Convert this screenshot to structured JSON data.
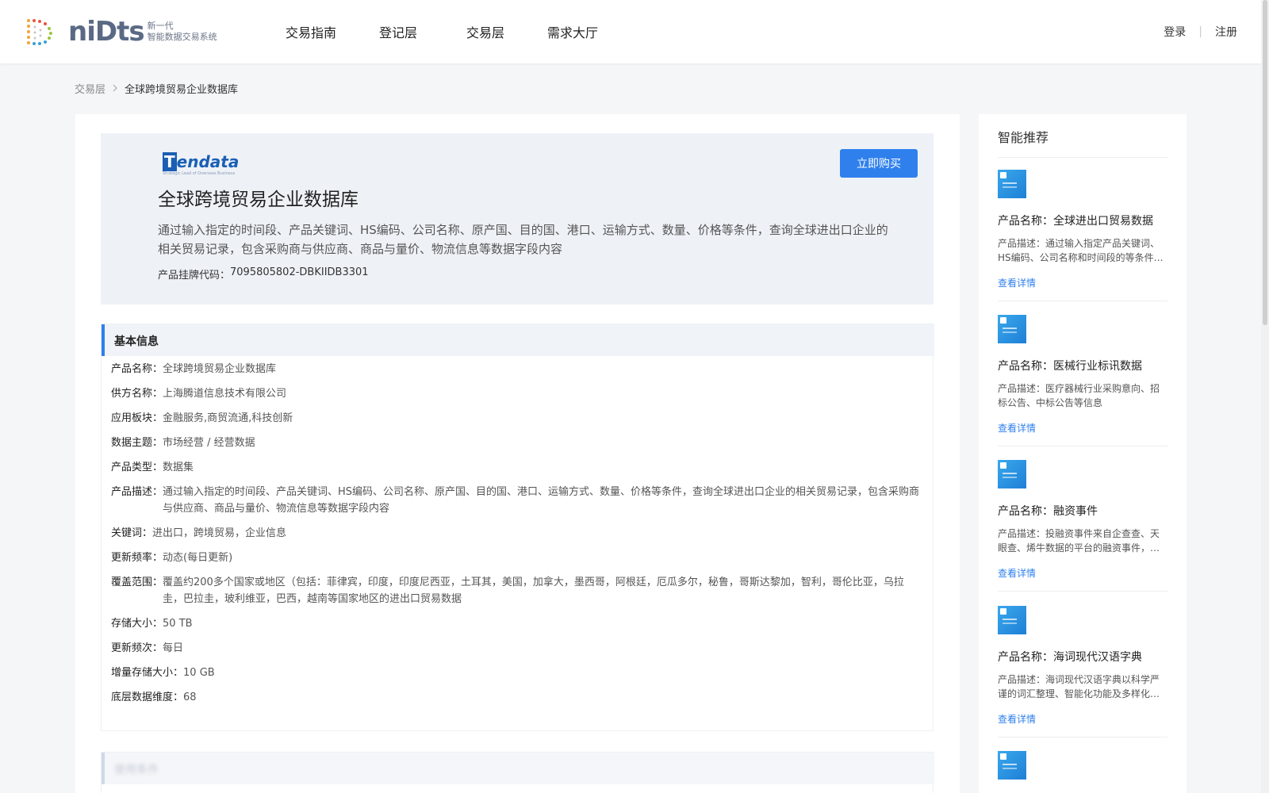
{
  "header": {
    "logo_text": "niDts",
    "logo_sub_line1": "新一代",
    "logo_sub_line2": "智能数据交易系统",
    "nav": [
      "交易指南",
      "登记层",
      "交易层",
      "需求大厅"
    ],
    "login": "登录",
    "separator": "|",
    "register": "注册"
  },
  "breadcrumb": {
    "parent": "交易层",
    "current": "全球跨境贸易企业数据库"
  },
  "hero": {
    "brand_main": "endata",
    "brand_letter": "T",
    "brand_sub": "Strategic Lead of Overseas Business",
    "buy_label": "立即购买",
    "title": "全球跨境贸易企业数据库",
    "description": "通过输入指定的时间段、产品关键词、HS编码、公司名称、原产国、目的国、港口、运输方式、数量、价格等条件，查询全球进出口企业的相关贸易记录，包含采购商与供应商、商品与量价、物流信息等数据字段内容",
    "code_label": "产品挂牌代码：",
    "code_value": "7095805802-DBKIIDB3301"
  },
  "basic_info": {
    "heading": "基本信息",
    "rows": [
      {
        "k": "产品名称：",
        "v": "全球跨境贸易企业数据库"
      },
      {
        "k": "供方名称：",
        "v": "上海腾道信息技术有限公司"
      },
      {
        "k": "应用板块：",
        "v": "金融服务,商贸流通,科技创新"
      },
      {
        "k": "数据主题：",
        "v": "市场经营 / 经营数据"
      },
      {
        "k": "产品类型：",
        "v": "数据集"
      },
      {
        "k": "产品描述：",
        "v": "通过输入指定的时间段、产品关键词、HS编码、公司名称、原产国、目的国、港口、运输方式、数量、价格等条件，查询全球进出口企业的相关贸易记录，包含采购商与供应商、商品与量价、物流信息等数据字段内容"
      },
      {
        "k": "关键词：",
        "v": "进出口，跨境贸易，企业信息"
      },
      {
        "k": "更新频率：",
        "v": "动态(每日更新)"
      },
      {
        "k": "覆盖范围：",
        "v": "覆盖约200多个国家或地区（包括：菲律宾，印度，印度尼西亚，土耳其，美国，加拿大，墨西哥，阿根廷，厄瓜多尔，秘鲁，哥斯达黎加，智利，哥伦比亚，乌拉圭，巴拉圭，玻利维亚，巴西，越南等国家地区的进出口贸易数据"
      },
      {
        "k": "存储大小：",
        "v": "50 TB"
      },
      {
        "k": "更新频次：",
        "v": "每日"
      },
      {
        "k": "增量存储大小：",
        "v": "10 GB"
      },
      {
        "k": "底层数据维度：",
        "v": "68"
      }
    ]
  },
  "usage_section": {
    "heading": "使用条件"
  },
  "sidebar": {
    "title": "智能推荐",
    "link_label": "查看详情",
    "items": [
      {
        "name": "产品名称：全球进出口贸易数据",
        "desc": "产品描述：通过输入指定产品关键词、HS编码、公司名称和时间段的等条件查询全球进出口贸易记录"
      },
      {
        "name": "产品名称：医械行业标讯数据",
        "desc": "产品描述：医疗器械行业采购意向、招标公告、中标公告等信息"
      },
      {
        "name": "产品名称：融资事件",
        "desc": "产品描述：投融资事件来自企查查、天眼查、烯牛数据的平台的融资事件，及公开信息"
      },
      {
        "name": "产品名称：海词现代汉语字典",
        "desc": "产品描述：海词现代汉语字典以科学严谨的词汇整理、智能化功能及多样化的释义"
      },
      {
        "name": "",
        "desc": ""
      }
    ]
  }
}
